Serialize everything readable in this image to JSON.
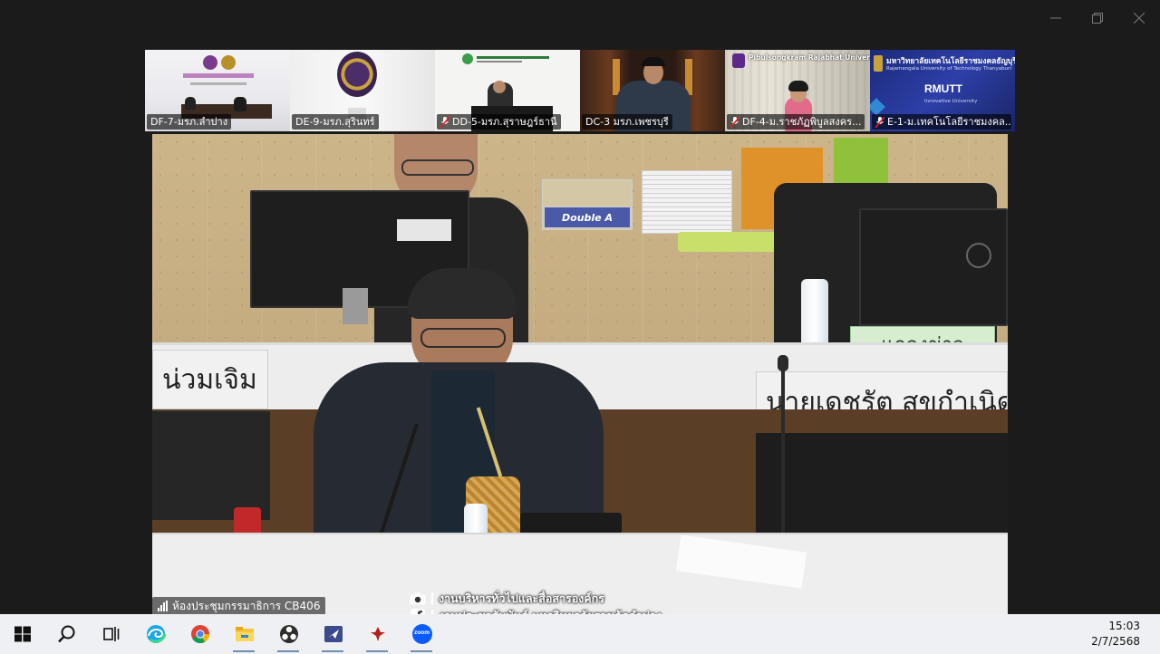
{
  "window": {
    "controls": {
      "minimize": "minimize",
      "restore": "restore",
      "close": "close"
    }
  },
  "participants": [
    {
      "label": "DF-7-มรภ.ลำปาง",
      "muted": false
    },
    {
      "label": "DE-9-มรภ.สุรินทร์",
      "muted": false
    },
    {
      "label": "DD-5-มรภ.สุราษฎร์ธานี",
      "muted": true
    },
    {
      "label": "DC-3 มรภ.เพชรบุรี",
      "muted": false
    },
    {
      "label": "DF-4-ม.ราชภัฏพิบูลสงคร...",
      "muted": true
    },
    {
      "label": "E-1-ม.เทคโนโลยีราชมงคล...",
      "muted": true
    }
  ],
  "thumbnail_text": {
    "pibulsongkram": "Pibulsongkram Rajabhat University",
    "rmutt_thai": "มหาวิทยาลัยเทคโนโลยีราชมงคลธัญบุรี",
    "rmutt_en": "Rajamangala University of Technology Thanyaburi",
    "rmutt_logo": "RMUTT",
    "rmutt_tag": "Innovative University"
  },
  "main_video": {
    "nameplate_left": "น่วมเจิม",
    "nameplate_right": "นายเดชรัต  สุขกำเนิด",
    "nameplate_green": "แถลงข่าว",
    "paper_label": "Double A",
    "room_name": "ห้องประชุมกรรมาธิการ CB406",
    "watermark_line1": "งานบริหารทั่วไปและสื่อสารองค์กร",
    "watermark_line2": "งานประชาสัมพันธ์ มหาวิทยาลัยราชภัฏลำปาง"
  },
  "taskbar": {
    "apps": [
      "start-icon",
      "search-icon",
      "task-view-icon",
      "edge-icon",
      "chrome-icon",
      "file-explorer-icon",
      "obs-icon",
      "app-icon",
      "emblem-icon",
      "zoom-icon"
    ],
    "zoom_label": "zoom",
    "time": "15:03",
    "date": "2/7/2568"
  },
  "colors": {
    "window_bg": "#1b1b1b",
    "taskbar_bg": "#eef0f3",
    "zoom_blue": "#0b5cff",
    "nameplate_green": "#d6edd0"
  }
}
